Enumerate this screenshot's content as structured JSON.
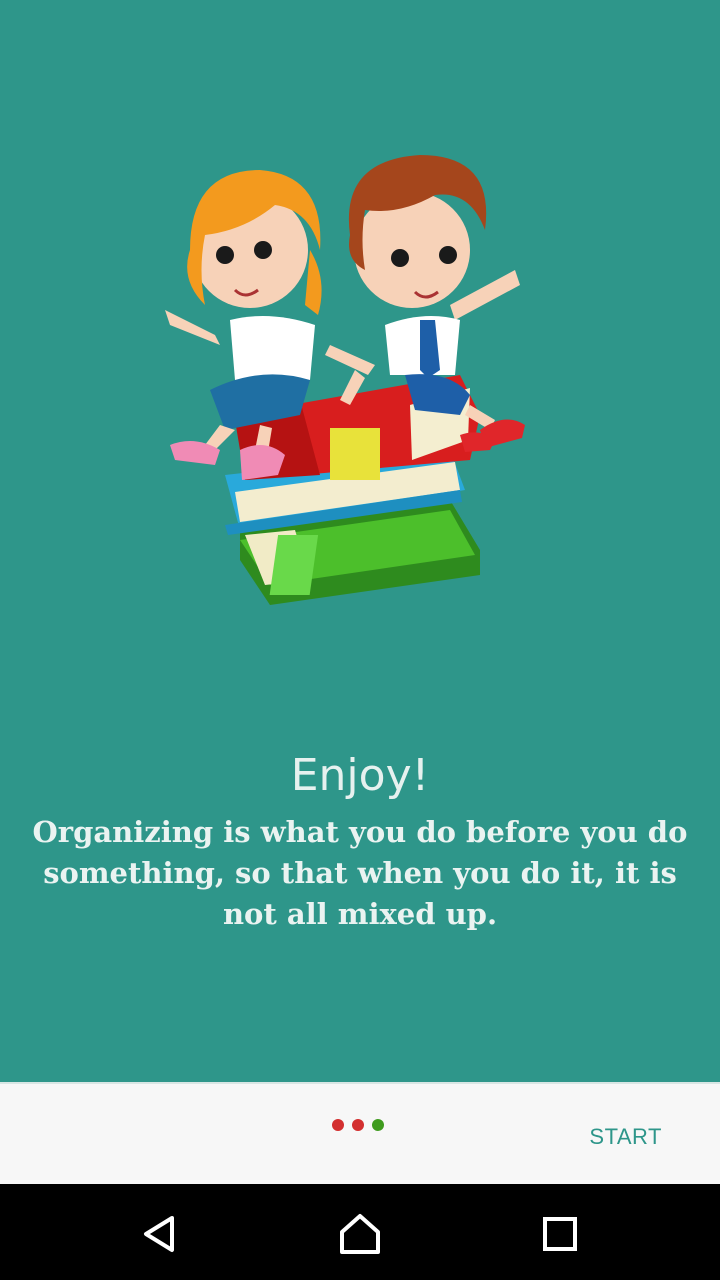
{
  "intro": {
    "title": "Enjoy!",
    "description": "Organizing is what you do before you do something, so that when you do it, it is not all mixed up.",
    "illustration_icon": "kids-on-books-illustration"
  },
  "pager": {
    "dots": [
      {
        "color": "#D32F2F",
        "state": "inactive"
      },
      {
        "color": "#D32F2F",
        "state": "inactive"
      },
      {
        "color": "#3F9B1E",
        "state": "active"
      }
    ],
    "start_label": "START"
  },
  "nav": {
    "back_icon": "back-triangle-icon",
    "home_icon": "home-icon",
    "recents_icon": "recents-square-icon"
  },
  "colors": {
    "background": "#2E968A",
    "bottom_bar": "#F7F7F7",
    "accent": "#2E968A"
  }
}
